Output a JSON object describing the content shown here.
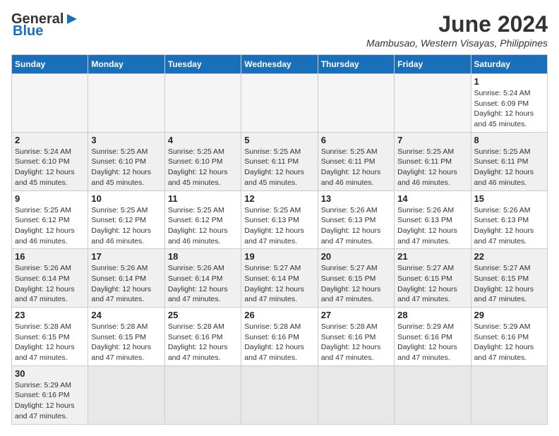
{
  "header": {
    "logo_general": "General",
    "logo_blue": "Blue",
    "month_title": "June 2024",
    "location": "Mambusao, Western Visayas, Philippines"
  },
  "weekdays": [
    "Sunday",
    "Monday",
    "Tuesday",
    "Wednesday",
    "Thursday",
    "Friday",
    "Saturday"
  ],
  "weeks": [
    {
      "bg": "white",
      "days": [
        {
          "num": "",
          "info": ""
        },
        {
          "num": "",
          "info": ""
        },
        {
          "num": "",
          "info": ""
        },
        {
          "num": "",
          "info": ""
        },
        {
          "num": "",
          "info": ""
        },
        {
          "num": "",
          "info": ""
        },
        {
          "num": "1",
          "info": "Sunrise: 5:24 AM\nSunset: 6:09 PM\nDaylight: 12 hours and 45 minutes."
        }
      ]
    },
    {
      "bg": "gray",
      "days": [
        {
          "num": "2",
          "info": "Sunrise: 5:24 AM\nSunset: 6:10 PM\nDaylight: 12 hours and 45 minutes."
        },
        {
          "num": "3",
          "info": "Sunrise: 5:25 AM\nSunset: 6:10 PM\nDaylight: 12 hours and 45 minutes."
        },
        {
          "num": "4",
          "info": "Sunrise: 5:25 AM\nSunset: 6:10 PM\nDaylight: 12 hours and 45 minutes."
        },
        {
          "num": "5",
          "info": "Sunrise: 5:25 AM\nSunset: 6:11 PM\nDaylight: 12 hours and 45 minutes."
        },
        {
          "num": "6",
          "info": "Sunrise: 5:25 AM\nSunset: 6:11 PM\nDaylight: 12 hours and 46 minutes."
        },
        {
          "num": "7",
          "info": "Sunrise: 5:25 AM\nSunset: 6:11 PM\nDaylight: 12 hours and 46 minutes."
        },
        {
          "num": "8",
          "info": "Sunrise: 5:25 AM\nSunset: 6:11 PM\nDaylight: 12 hours and 46 minutes."
        }
      ]
    },
    {
      "bg": "white",
      "days": [
        {
          "num": "9",
          "info": "Sunrise: 5:25 AM\nSunset: 6:12 PM\nDaylight: 12 hours and 46 minutes."
        },
        {
          "num": "10",
          "info": "Sunrise: 5:25 AM\nSunset: 6:12 PM\nDaylight: 12 hours and 46 minutes."
        },
        {
          "num": "11",
          "info": "Sunrise: 5:25 AM\nSunset: 6:12 PM\nDaylight: 12 hours and 46 minutes."
        },
        {
          "num": "12",
          "info": "Sunrise: 5:25 AM\nSunset: 6:13 PM\nDaylight: 12 hours and 47 minutes."
        },
        {
          "num": "13",
          "info": "Sunrise: 5:26 AM\nSunset: 6:13 PM\nDaylight: 12 hours and 47 minutes."
        },
        {
          "num": "14",
          "info": "Sunrise: 5:26 AM\nSunset: 6:13 PM\nDaylight: 12 hours and 47 minutes."
        },
        {
          "num": "15",
          "info": "Sunrise: 5:26 AM\nSunset: 6:13 PM\nDaylight: 12 hours and 47 minutes."
        }
      ]
    },
    {
      "bg": "gray",
      "days": [
        {
          "num": "16",
          "info": "Sunrise: 5:26 AM\nSunset: 6:14 PM\nDaylight: 12 hours and 47 minutes."
        },
        {
          "num": "17",
          "info": "Sunrise: 5:26 AM\nSunset: 6:14 PM\nDaylight: 12 hours and 47 minutes."
        },
        {
          "num": "18",
          "info": "Sunrise: 5:26 AM\nSunset: 6:14 PM\nDaylight: 12 hours and 47 minutes."
        },
        {
          "num": "19",
          "info": "Sunrise: 5:27 AM\nSunset: 6:14 PM\nDaylight: 12 hours and 47 minutes."
        },
        {
          "num": "20",
          "info": "Sunrise: 5:27 AM\nSunset: 6:15 PM\nDaylight: 12 hours and 47 minutes."
        },
        {
          "num": "21",
          "info": "Sunrise: 5:27 AM\nSunset: 6:15 PM\nDaylight: 12 hours and 47 minutes."
        },
        {
          "num": "22",
          "info": "Sunrise: 5:27 AM\nSunset: 6:15 PM\nDaylight: 12 hours and 47 minutes."
        }
      ]
    },
    {
      "bg": "white",
      "days": [
        {
          "num": "23",
          "info": "Sunrise: 5:28 AM\nSunset: 6:15 PM\nDaylight: 12 hours and 47 minutes."
        },
        {
          "num": "24",
          "info": "Sunrise: 5:28 AM\nSunset: 6:15 PM\nDaylight: 12 hours and 47 minutes."
        },
        {
          "num": "25",
          "info": "Sunrise: 5:28 AM\nSunset: 6:16 PM\nDaylight: 12 hours and 47 minutes."
        },
        {
          "num": "26",
          "info": "Sunrise: 5:28 AM\nSunset: 6:16 PM\nDaylight: 12 hours and 47 minutes."
        },
        {
          "num": "27",
          "info": "Sunrise: 5:28 AM\nSunset: 6:16 PM\nDaylight: 12 hours and 47 minutes."
        },
        {
          "num": "28",
          "info": "Sunrise: 5:29 AM\nSunset: 6:16 PM\nDaylight: 12 hours and 47 minutes."
        },
        {
          "num": "29",
          "info": "Sunrise: 5:29 AM\nSunset: 6:16 PM\nDaylight: 12 hours and 47 minutes."
        }
      ]
    },
    {
      "bg": "gray",
      "days": [
        {
          "num": "30",
          "info": "Sunrise: 5:29 AM\nSunset: 6:16 PM\nDaylight: 12 hours and 47 minutes."
        },
        {
          "num": "",
          "info": ""
        },
        {
          "num": "",
          "info": ""
        },
        {
          "num": "",
          "info": ""
        },
        {
          "num": "",
          "info": ""
        },
        {
          "num": "",
          "info": ""
        },
        {
          "num": "",
          "info": ""
        }
      ]
    }
  ]
}
